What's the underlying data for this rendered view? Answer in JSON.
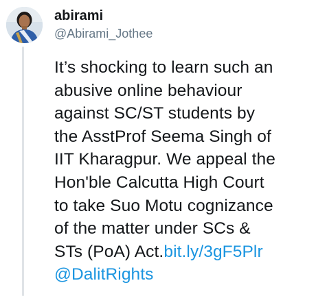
{
  "author": {
    "display_name": "abirami",
    "handle": "@Abirami_Jothee"
  },
  "tweet": {
    "lines": [
      "It’s shocking to learn such an",
      "abusive online behaviour",
      "against SC/ST students by",
      "the AsstProf Seema Singh of",
      "IIT Kharagpur. We appeal the",
      "Hon'ble Calcutta High Court",
      "to take Suo Motu cognizance",
      "of the matter under SCs &",
      "STs (PoA) Act."
    ],
    "link_text": "bit.ly/3gF5Plr",
    "mention": "@DalitRights"
  },
  "colors": {
    "link": "#1b95e0",
    "secondary_text": "#657786",
    "thread_line": "#dfe3e7"
  }
}
